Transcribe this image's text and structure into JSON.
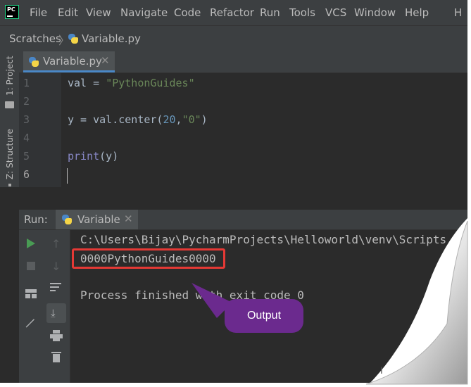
{
  "menu": {
    "file": "File",
    "edit": "Edit",
    "view": "View",
    "navigate": "Navigate",
    "code": "Code",
    "refactor": "Refactor",
    "run": "Run",
    "tools": "Tools",
    "vcs": "VCS",
    "window": "Window",
    "help": "Help",
    "overflow": "H"
  },
  "breadcrumb": {
    "root": "Scratches",
    "file": "Variable.py"
  },
  "side_tabs": {
    "project": "1: Project",
    "structure": "Z: Structure"
  },
  "editor": {
    "tab_label": "Variable.py",
    "line_numbers": [
      "1",
      "2",
      "3",
      "4",
      "5",
      "6"
    ],
    "code": {
      "line1_var": "val = ",
      "line1_str": "\"PythonGuides\"",
      "line3_a": "y = val.center(",
      "line3_num": "20",
      "line3_b": ",",
      "line3_str": "\"0\"",
      "line3_c": ")",
      "line5_fn": "print",
      "line5_b": "(y)"
    }
  },
  "run_panel": {
    "label": "Run:",
    "tab_label": "Variable",
    "command": "C:\\Users\\Bijay\\PycharmProjects\\Helloworld\\venv\\Scripts",
    "output": "0000PythonGuides0000",
    "exit_message": "Process finished with exit code 0"
  },
  "callout": {
    "text": "Output"
  },
  "colors": {
    "callout_bg": "#6b2a8e",
    "highlight_border": "#e53935",
    "string": "#6a8759",
    "number": "#6897bb",
    "builtin": "#8888c6"
  }
}
